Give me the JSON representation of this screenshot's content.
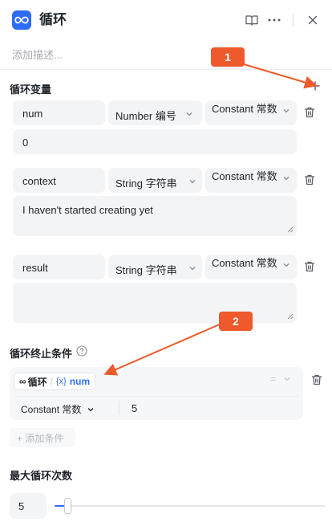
{
  "header": {
    "title": "循环",
    "description_placeholder": "添加描述..."
  },
  "loop_variables": {
    "section_title": "循环变量",
    "rows": [
      {
        "name": "num",
        "type": "Number 编号",
        "mode": "Constant 常数",
        "value": "0"
      },
      {
        "name": "context",
        "type": "String 字符串",
        "mode": "Constant 常数",
        "value": "I haven't started creating yet"
      },
      {
        "name": "result",
        "type": "String 字符串",
        "mode": "Constant 常数",
        "value": ""
      }
    ]
  },
  "termination": {
    "section_title": "循环终止条件",
    "tag_icon": "∞",
    "tag_source": "循环",
    "tag_sep": "/",
    "tag_var_icon": "{x}",
    "tag_var": "num",
    "operator": "=",
    "value_mode": "Constant 常数",
    "value": "5",
    "add_condition": "+ 添加条件"
  },
  "max_loops": {
    "section_title": "最大循环次数",
    "value": "5",
    "slider_fraction": 0.05
  },
  "annotations": [
    {
      "label": "1"
    },
    {
      "label": "2"
    }
  ],
  "colors": {
    "accent": "#2f6cf6",
    "annotation": "#ee5a2b"
  },
  "icons": [
    "infinity-icon",
    "book-icon",
    "more-icon",
    "close-icon",
    "plus-icon",
    "chevron-down-icon",
    "trash-icon",
    "help-icon"
  ]
}
